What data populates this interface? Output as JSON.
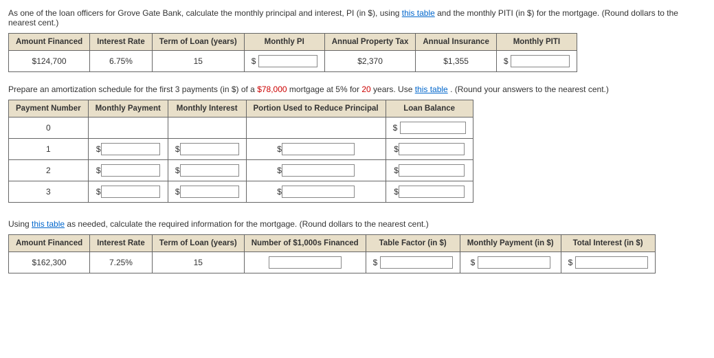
{
  "p1": {
    "text_before": "As one of the loan officers for Grove Gate Bank, calculate the monthly principal and interest, PI (in $), using ",
    "link": "this table",
    "text_after": " and the monthly PITI (in $) for the mortgage. (Round dollars to the nearest cent.)"
  },
  "t1": {
    "headers": {
      "amount": "Amount Financed",
      "rate": "Interest Rate",
      "term": "Term of Loan (years)",
      "pi": "Monthly PI",
      "tax": "Annual Property Tax",
      "ins": "Annual Insurance",
      "piti": "Monthly PITI"
    },
    "row": {
      "amount": "$124,700",
      "rate": "6.75%",
      "term": "15",
      "tax": "$2,370",
      "ins": "$1,355"
    }
  },
  "p2": {
    "a": "Prepare an amortization schedule for the first 3 payments (in $) of a ",
    "amt": "$78,000",
    "b": " mortgage at 5% for ",
    "yrs": "20",
    "c": " years. Use ",
    "link": "this table",
    "d": ". (Round your answers to the nearest cent.)"
  },
  "t2": {
    "headers": {
      "num": "Payment Number",
      "pay": "Monthly Payment",
      "int": "Monthly Interest",
      "prin": "Portion Used to Reduce Principal",
      "bal": "Loan Balance"
    },
    "rows": [
      "0",
      "1",
      "2",
      "3"
    ]
  },
  "p3": {
    "a": "Using ",
    "link": "this table",
    "b": " as needed, calculate the required information for the mortgage. (Round dollars to the nearest cent.)"
  },
  "t3": {
    "headers": {
      "amount": "Amount Financed",
      "rate": "Interest Rate",
      "term": "Term of Loan (years)",
      "num": "Number of $1,000s Financed",
      "factor": "Table Factor (in $)",
      "monthly": "Monthly Payment (in $)",
      "total": "Total Interest (in $)"
    },
    "row": {
      "amount": "$162,300",
      "rate": "7.25%",
      "term": "15"
    }
  },
  "sym": {
    "dollar": "$"
  }
}
